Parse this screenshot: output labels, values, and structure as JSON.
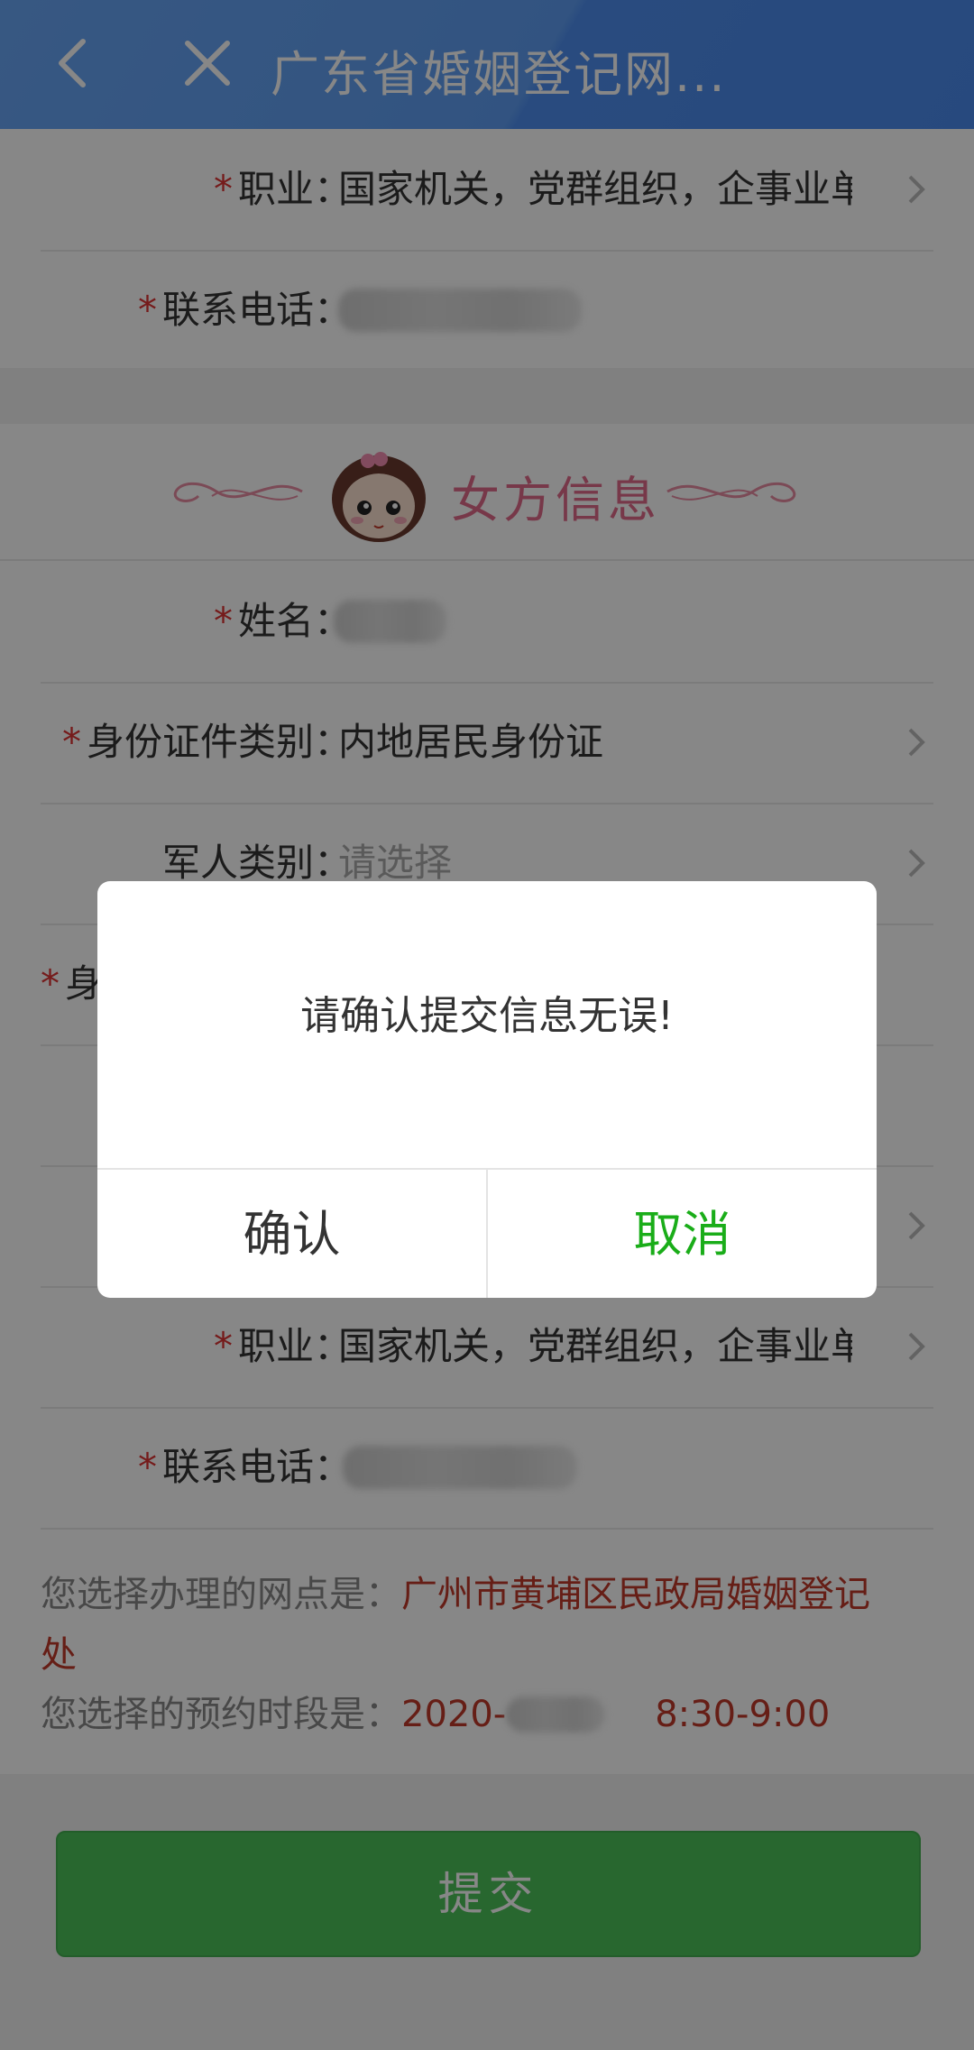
{
  "header": {
    "title": "广东省婚姻登记网...",
    "back_icon": "chevron-left-icon",
    "close_icon": "close-icon"
  },
  "top_section": {
    "rows": [
      {
        "required": "*",
        "label": "职业：",
        "value": "国家机关，党群组织，企事业单"
      },
      {
        "required": "*",
        "label": "联系电话：",
        "value": ""
      }
    ]
  },
  "female_section": {
    "title": "女方信息",
    "rows": [
      {
        "required": "*",
        "label": "姓名：",
        "value": ""
      },
      {
        "required": "*",
        "label": "身份证件类别：",
        "value": "内地居民身份证"
      },
      {
        "required": "",
        "label": "军人类别：",
        "value": "请选择"
      },
      {
        "required": "*",
        "label": "身",
        "value": ""
      },
      {
        "required": "",
        "label": "",
        "value": ""
      },
      {
        "required": "",
        "label": "",
        "value": ""
      },
      {
        "required": "*",
        "label": "职业：",
        "value": "国家机关，党群组织，企事业单"
      },
      {
        "required": "*",
        "label": "联系电话：",
        "value": ""
      }
    ],
    "office_label": "您选择办理的网点是：",
    "office_value_line1": "广州市黄埔区民政局婚姻登记",
    "office_value_line2": "处",
    "slot_label": "您选择的预约时段是：",
    "slot_date": "2020-",
    "slot_time": "8:30-9:00"
  },
  "submit_label": "提交",
  "dialog": {
    "message": "请确认提交信息无误!",
    "confirm_label": "确认",
    "cancel_label": "取消"
  },
  "colors": {
    "header_blue": "#5f9ef3",
    "required_red": "#d33",
    "section_pink": "#e06a8a",
    "submit_green": "#4cc25a",
    "cancel_green": "#1aad19"
  }
}
